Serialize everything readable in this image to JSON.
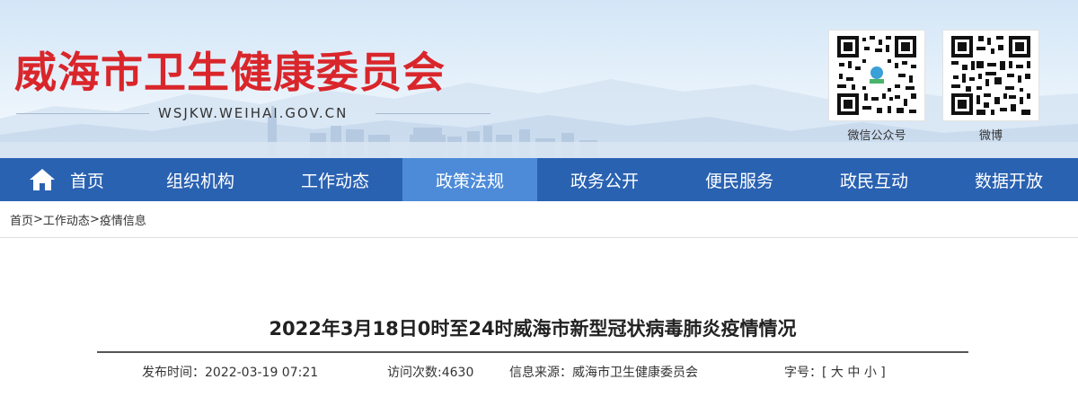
{
  "header": {
    "site_title": "威海市卫生健康委员会",
    "site_url": "WSJKW.WEIHAI.GOV.CN",
    "qr_codes": [
      {
        "label": "微信公众号",
        "icon": "wechat-qr-icon"
      },
      {
        "label": "微博",
        "icon": "weibo-qr-icon"
      }
    ],
    "title_color": "#d9262b"
  },
  "nav": {
    "items": [
      {
        "label": "首页",
        "icon": "home-icon"
      },
      {
        "label": "组织机构"
      },
      {
        "label": "工作动态"
      },
      {
        "label": "政策法规",
        "active": true
      },
      {
        "label": "政务公开"
      },
      {
        "label": "便民服务"
      },
      {
        "label": "政民互动"
      },
      {
        "label": "数据开放"
      }
    ],
    "bar_color": "#2a62b2",
    "active_color": "#4d8bd8"
  },
  "breadcrumb": {
    "items": [
      "首页",
      "工作动态",
      "疫情信息"
    ],
    "separator": ">"
  },
  "article": {
    "title": "2022年3月18日0时至24时威海市新型冠状病毒肺炎疫情情况",
    "publish_time_label": "发布时间：",
    "publish_time": "2022-03-19 07:21",
    "visits_label": "访问次数:",
    "visits": "4630",
    "source_label": "信息来源：",
    "source": "威海市卫生健康委员会",
    "font_size_label": "字号：",
    "font_size_open": "[",
    "font_sizes": [
      "大",
      "中",
      "小"
    ],
    "font_size_close": "]"
  }
}
